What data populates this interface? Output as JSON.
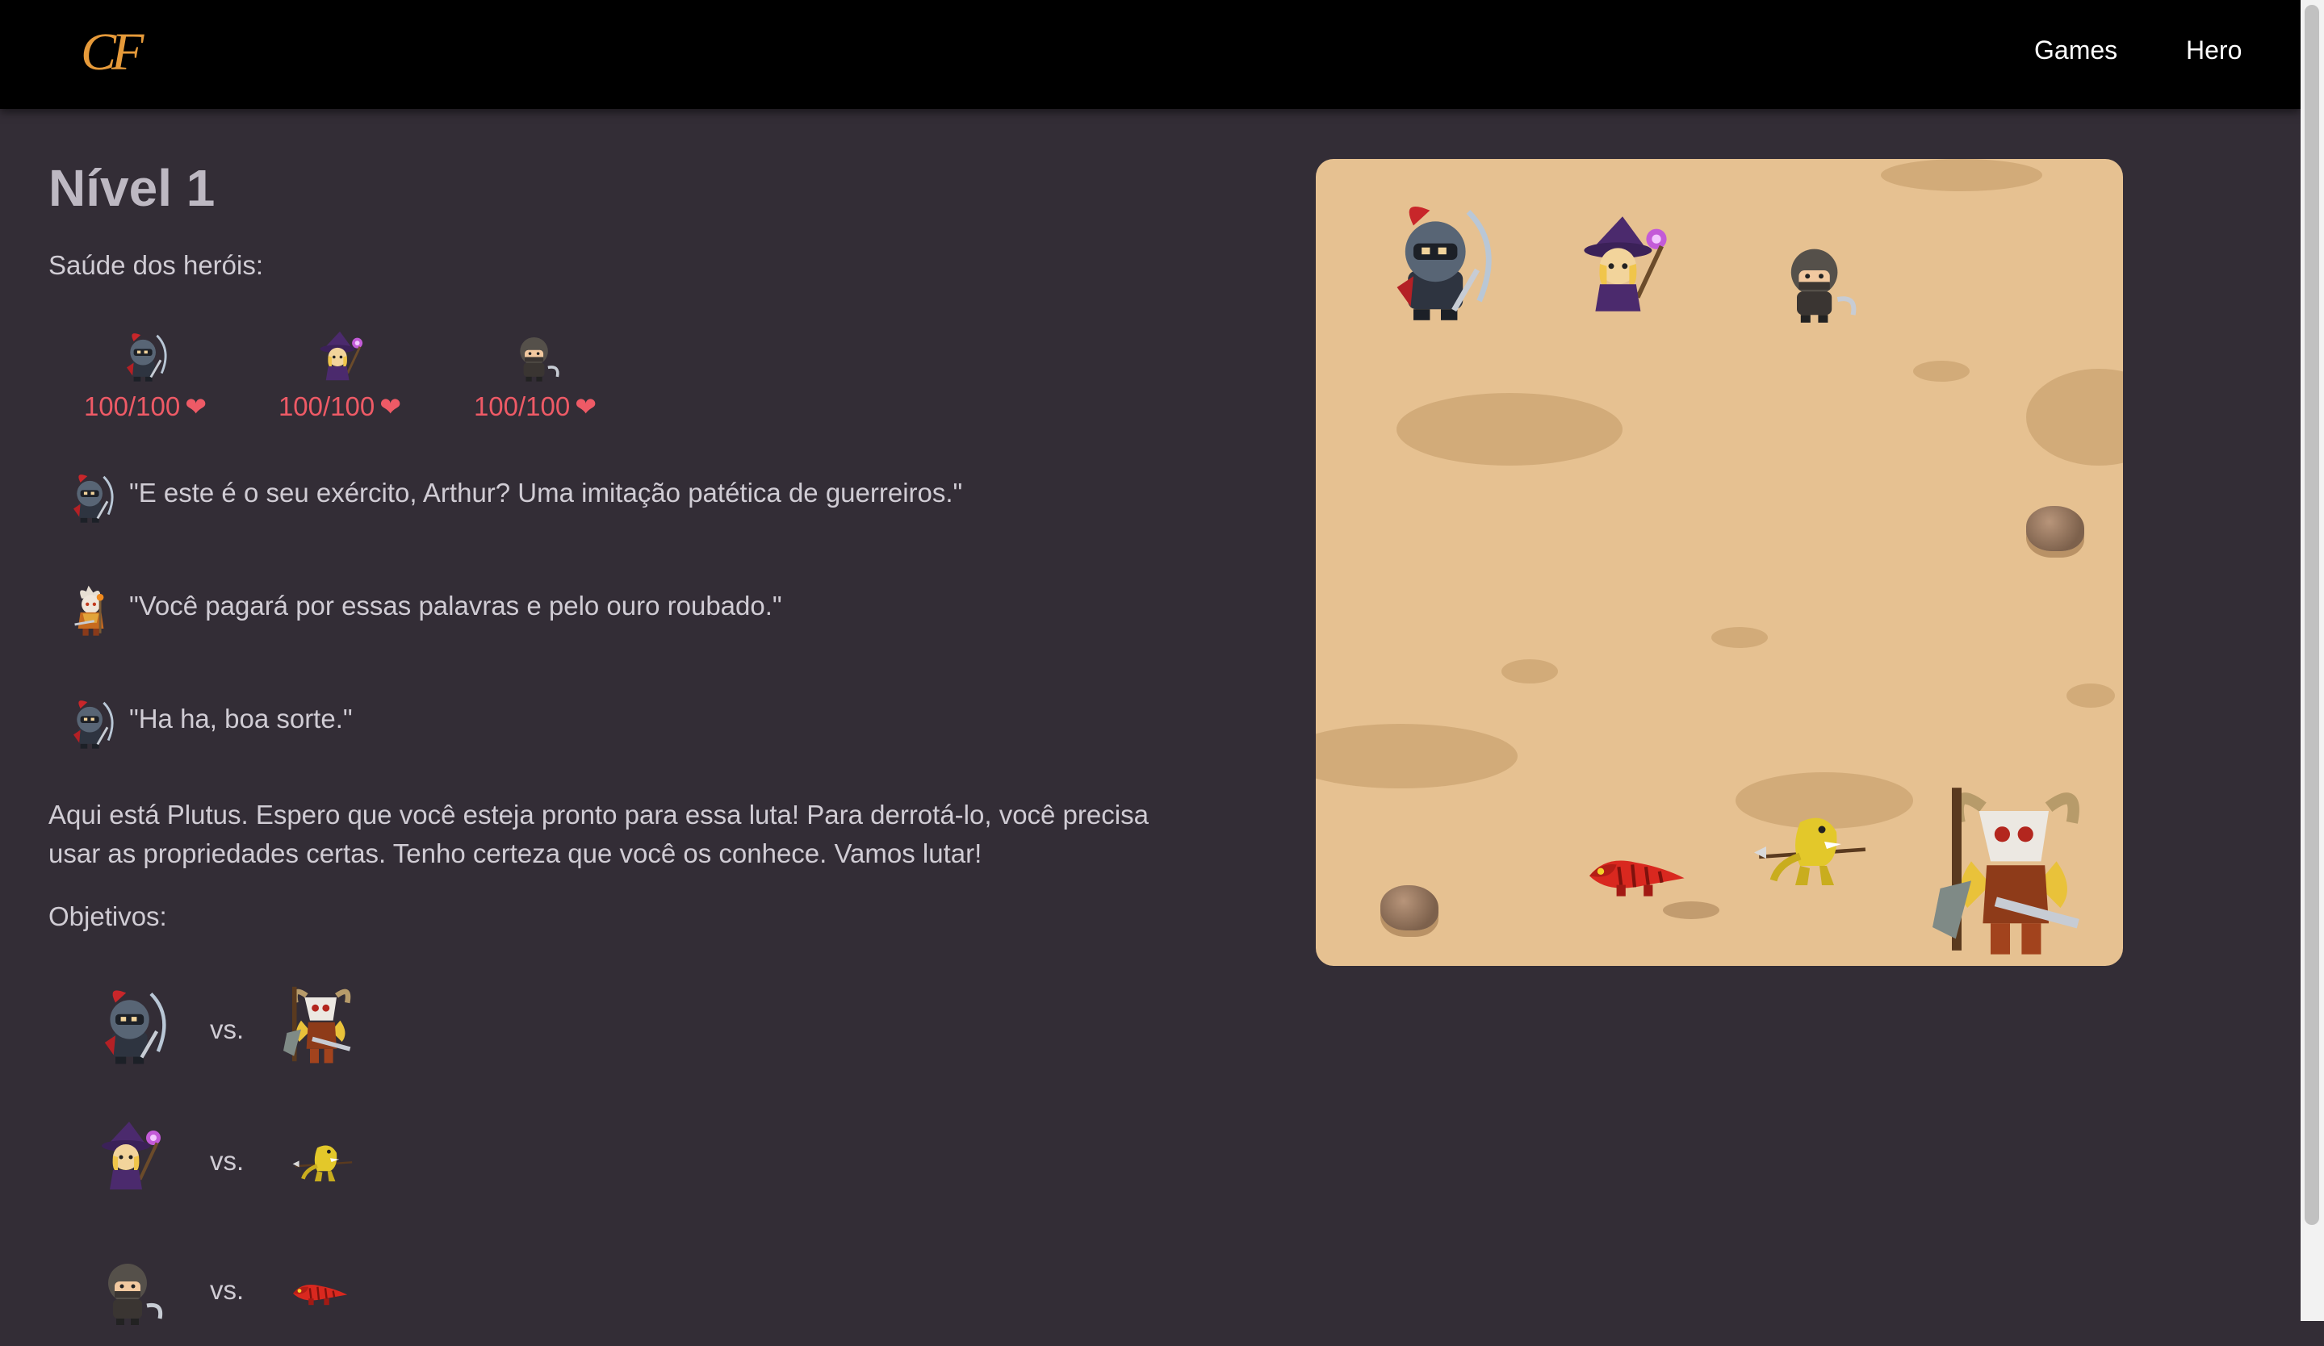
{
  "nav": {
    "logo_text": "CF",
    "links": [
      {
        "label": "Games"
      },
      {
        "label": "Hero"
      }
    ]
  },
  "level": {
    "title": "Nível 1",
    "health_label": "Saúde dos heróis:",
    "heroes": [
      {
        "sprite": "knight-icon",
        "health": "100/100",
        "heart": "❤"
      },
      {
        "sprite": "wizard-icon",
        "health": "100/100",
        "heart": "❤"
      },
      {
        "sprite": "rogue-icon",
        "health": "100/100",
        "heart": "❤"
      }
    ],
    "dialogue": [
      {
        "speaker_icon": "knight-icon",
        "text": "\"E este é o seu exército, Arthur? Uma imitação patética de guerreiros.\""
      },
      {
        "speaker_icon": "arthur-icon",
        "text": "\"Você pagará por essas palavras e pelo ouro roubado.\""
      },
      {
        "speaker_icon": "knight-icon",
        "text": "\"Ha ha, boa sorte.\""
      }
    ],
    "description": "Aqui está Plutus. Espero que você esteja pronto para essa luta! Para derrotá-lo, você precisa usar as propriedades certas. Tenho certeza que você os conhece. Vamos lutar!",
    "objectives_label": "Objetivos:",
    "objectives": [
      {
        "hero": "knight-icon",
        "vs": "vs.",
        "enemy": "skull-warrior-icon"
      },
      {
        "hero": "wizard-icon",
        "vs": "vs.",
        "enemy": "yellow-lizard-spear-icon"
      },
      {
        "hero": "rogue-icon",
        "vs": "vs.",
        "enemy": "red-lizard-icon"
      }
    ]
  },
  "board": {
    "top_units": [
      "knight-icon",
      "wizard-icon",
      "rogue-icon"
    ],
    "bottom_units": [
      "red-lizard-icon",
      "yellow-lizard-spear-icon",
      "skull-warrior-icon"
    ],
    "obstacles": [
      "rock-icon",
      "rock-icon"
    ]
  },
  "colors": {
    "background": "#332d36",
    "navbar": "#000000",
    "health": "#ee5a66",
    "board_sand": "#e6c191",
    "logo": "#e69a3a"
  }
}
